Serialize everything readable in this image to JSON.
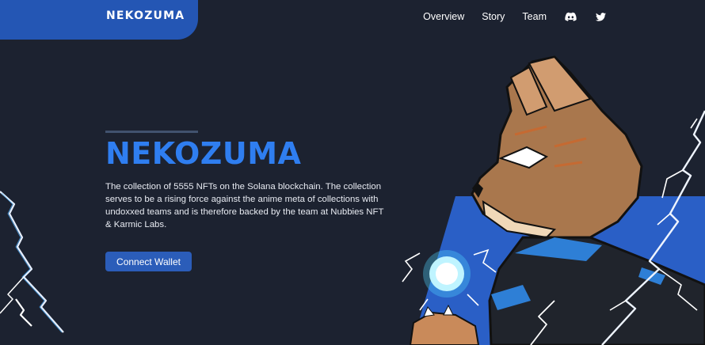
{
  "brand": {
    "logo_text": "NEKOZUMA",
    "accent": "#2456b4"
  },
  "nav": {
    "items": [
      {
        "label": "Overview"
      },
      {
        "label": "Story"
      },
      {
        "label": "Team"
      }
    ],
    "icons": [
      "discord-icon",
      "twitter-icon"
    ]
  },
  "hero": {
    "title": "NEKOZUMA",
    "title_color": "#2f7ef0",
    "description": "The collection  of 5555 NFTs on the Solana blockchain. The collection serves to be a rising force against the anime meta of collections with undoxxed teams and is therefore backed by the team at Nubbies NFT & Karmic Labs.",
    "cta_label": "Connect Wallet"
  },
  "colors": {
    "background": "#1c2230",
    "button": "#2b5db9"
  }
}
